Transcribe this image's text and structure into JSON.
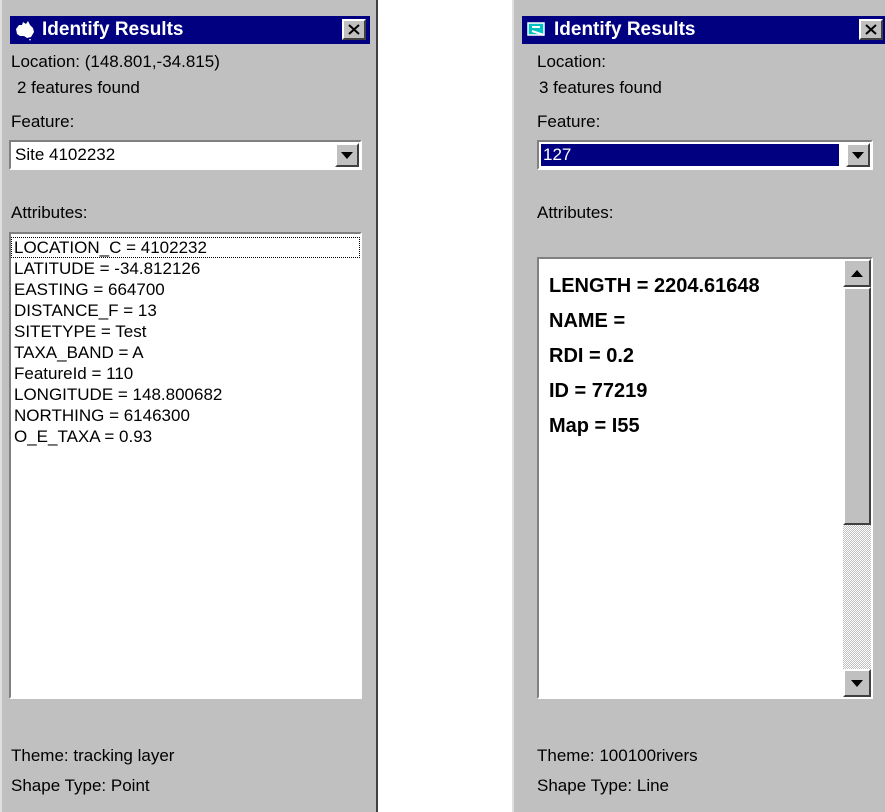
{
  "left_panel": {
    "title": "Identify Results",
    "icon": "australia-map-icon",
    "location": "Location:  (148.801,-34.815)",
    "features_found": "2 features found",
    "feature_label": "Feature:",
    "feature_value": "Site 4102232",
    "attributes_label": "Attributes:",
    "attributes": [
      "LOCATION_C = 4102232",
      "LATITUDE = -34.812126",
      "EASTING = 664700",
      "DISTANCE_F = 13",
      "SITETYPE = Test",
      "TAXA_BAND = A",
      "FeatureId = 110",
      "LONGITUDE = 148.800682",
      "NORTHING = 6146300",
      "O_E_TAXA = 0.93"
    ],
    "theme": "Theme:  tracking layer",
    "shape_type": "Shape Type:  Point"
  },
  "right_panel": {
    "title": "Identify Results",
    "icon": "layer-icon",
    "location": "Location:",
    "features_found": "3 features found",
    "feature_label": "Feature:",
    "feature_value": "127",
    "attributes_label": "Attributes:",
    "attributes": [
      "LENGTH = 2204.61648",
      "NAME =",
      "RDI = 0.2",
      "ID = 77219",
      "Map = I55"
    ],
    "theme": "Theme:  100100rivers",
    "shape_type": "Shape Type:  Line"
  },
  "colors": {
    "titlebar": "#000080",
    "panel": "#c0c0c0",
    "selection": "#000080"
  }
}
